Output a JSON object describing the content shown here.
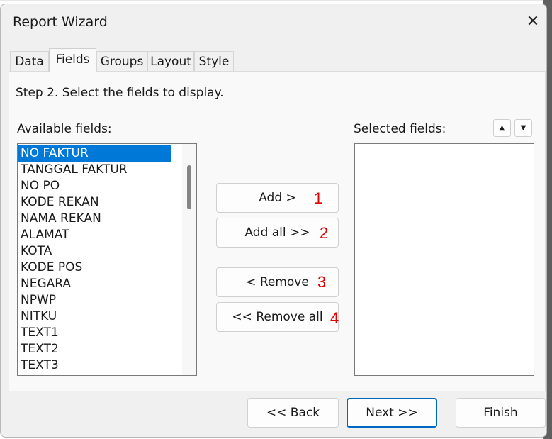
{
  "dialog": {
    "title": "Report Wizard",
    "close_icon": "close-icon",
    "tabs": [
      {
        "label": "Data",
        "active": false
      },
      {
        "label": "Fields",
        "active": true
      },
      {
        "label": "Groups",
        "active": false
      },
      {
        "label": "Layout",
        "active": false
      },
      {
        "label": "Style",
        "active": false
      }
    ],
    "step_text": "Step 2. Select the fields to display.",
    "available_label": "Available fields:",
    "selected_label": "Selected fields:",
    "available_fields": [
      "NO FAKTUR",
      "TANGGAL FAKTUR",
      "NO PO",
      "KODE REKAN",
      "NAMA REKAN",
      "ALAMAT",
      "KOTA",
      "KODE POS",
      "NEGARA",
      "NPWP",
      "NITKU",
      "TEXT1",
      "TEXT2",
      "TEXT3"
    ],
    "selected_field_index": 0,
    "selected_fields": [],
    "buttons": {
      "add": "Add >",
      "add_all": "Add all >>",
      "remove": "< Remove",
      "remove_all": "<< Remove all",
      "move_up_icon": "arrow-up-icon",
      "move_down_icon": "arrow-down-icon"
    },
    "annotations": [
      "1",
      "2",
      "3",
      "4"
    ],
    "annotation_color": "#e00000",
    "footer": {
      "back": "<< Back",
      "next": "Next >>",
      "finish": "Finish"
    },
    "accent_color": "#0078d7"
  }
}
